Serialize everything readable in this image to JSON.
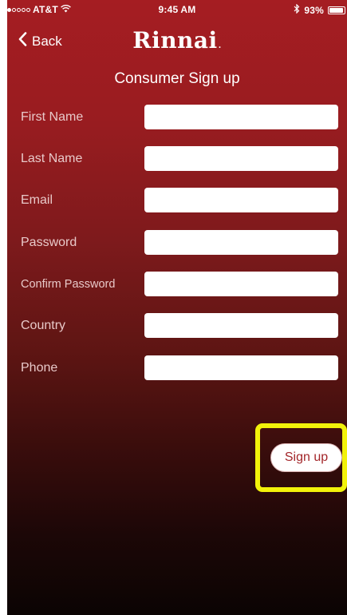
{
  "status_bar": {
    "carrier": "AT&T",
    "time": "9:45 AM",
    "battery": "93%",
    "icons": [
      "signal-dots-icon",
      "wifi-icon",
      "bluetooth-icon",
      "battery-icon"
    ]
  },
  "nav": {
    "back_label": "Back",
    "logo_text": "Rinnai",
    "logo_dot": ".",
    "icons": [
      "chevron-left-icon"
    ]
  },
  "page": {
    "title": "Consumer Sign up"
  },
  "form": {
    "fields": [
      {
        "label": "First Name",
        "value": "",
        "placeholder": ""
      },
      {
        "label": "Last Name",
        "value": "",
        "placeholder": ""
      },
      {
        "label": "Email",
        "value": "",
        "placeholder": ""
      },
      {
        "label": "Password",
        "value": "",
        "placeholder": ""
      },
      {
        "label": "Confirm Password",
        "value": "",
        "placeholder": ""
      },
      {
        "label": "Country",
        "value": "",
        "placeholder": ""
      },
      {
        "label": "Phone",
        "value": "",
        "placeholder": ""
      }
    ],
    "submit_label": "Sign up"
  },
  "colors": {
    "brand_red": "#a51d22",
    "highlight_yellow": "#f2f20a",
    "button_text": "#a3262a"
  }
}
